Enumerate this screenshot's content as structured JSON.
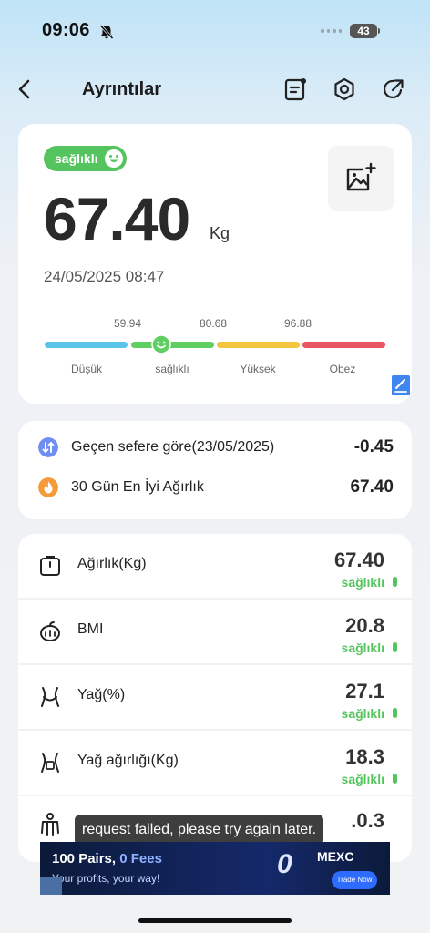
{
  "status_bar": {
    "time": "09:06",
    "battery": "43"
  },
  "nav": {
    "title": "Ayrıntılar"
  },
  "summary": {
    "badge": "sağlıklı",
    "weight": "67.40",
    "unit": "Kg",
    "date": "24/05/2025 08:47",
    "scale": {
      "thresholds": [
        "59.94",
        "80.68",
        "96.88"
      ],
      "labels": [
        "Düşük",
        "sağlıklı",
        "Yüksek",
        "Obez"
      ],
      "colors": [
        "#5bc4ea",
        "#5fcf63",
        "#f3c63d",
        "#ea5563"
      ]
    }
  },
  "comparison": {
    "rows": [
      {
        "label": "Geçen sefere göre(23/05/2025)",
        "value": "-0.45",
        "icon": "compare-icon",
        "color": "#6f8ef1"
      },
      {
        "label": "30 Gün En İyi Ağırlık",
        "value": "67.40",
        "icon": "flame-icon",
        "color": "#f59b3a"
      }
    ]
  },
  "metrics": [
    {
      "label": "Ağırlık(Kg)",
      "value": "67.40",
      "status": "sağlıklı",
      "icon": "scale-icon"
    },
    {
      "label": "BMI",
      "value": "20.8",
      "status": "sağlıklı",
      "icon": "bmi-icon"
    },
    {
      "label": "Yağ(%)",
      "value": "27.1",
      "status": "sağlıklı",
      "icon": "body-fat-icon"
    },
    {
      "label": "Yağ ağırlığı(Kg)",
      "value": "18.3",
      "status": "sağlıklı",
      "icon": "fat-weight-icon"
    },
    {
      "label": "",
      "value": ".0.3",
      "status": "",
      "icon": "muscle-icon"
    }
  ],
  "toast": "request failed, please try again later.",
  "ad": {
    "title_part1": "100 Pairs, ",
    "title_part2": "0 Fees",
    "subtitle": "Your profits, your way!",
    "zero": "0",
    "brand": "MEXC",
    "cta": "Trade Now"
  }
}
